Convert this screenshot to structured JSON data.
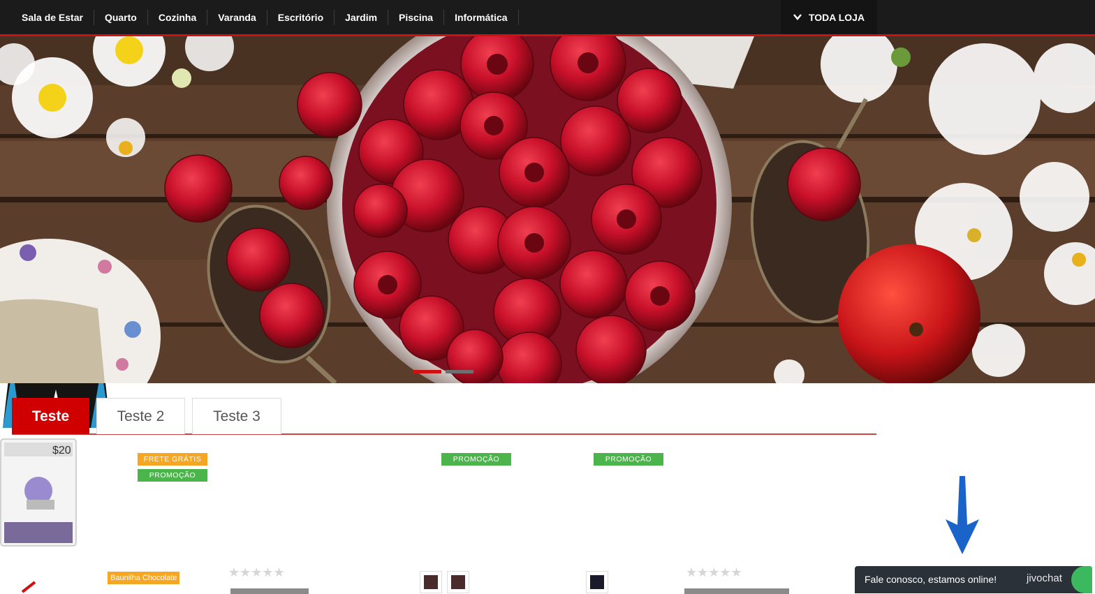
{
  "nav": {
    "items": [
      "Sala de Estar",
      "Quarto",
      "Cozinha",
      "Varanda",
      "Escritório",
      "Jardim",
      "Piscina",
      "Informática"
    ],
    "store_label": "TODA LOJA",
    "store_icon": "chevron-down-icon"
  },
  "hero": {
    "slide_count": 2,
    "active_slide": 1,
    "brand_color": "#d01010"
  },
  "tabs": [
    {
      "label": "Teste",
      "active": true
    },
    {
      "label": "Teste 2",
      "active": false
    },
    {
      "label": "Teste 3",
      "active": false
    }
  ],
  "products": [
    {
      "badges": [
        "FRETE GRÁTIS",
        "PROMOÇÃO"
      ],
      "flavor_label": "Baunilha Chocolate"
    },
    {
      "badges": [],
      "rating": 0
    },
    {
      "badges": [
        "PROMOÇÃO"
      ]
    },
    {
      "badges": [
        "PROMOÇÃO"
      ]
    },
    {
      "badges": [],
      "rating": 0,
      "card_value": "$20"
    }
  ],
  "chat": {
    "message": "Fale conosco, estamos online!",
    "brand": "jivochat"
  }
}
